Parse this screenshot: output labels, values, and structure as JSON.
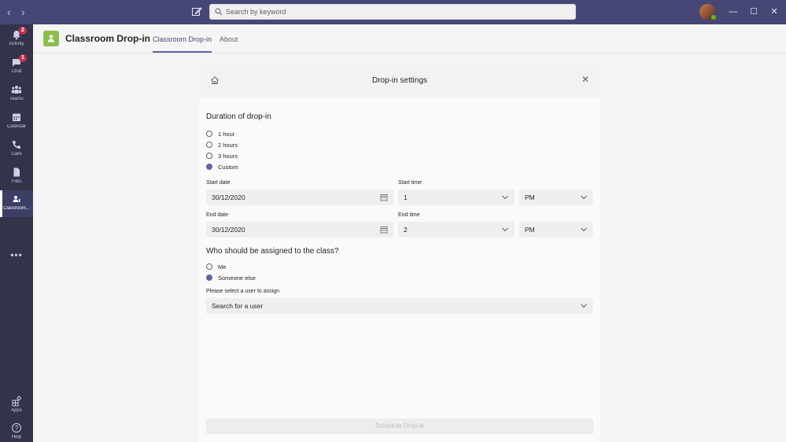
{
  "titlebar": {
    "search_placeholder": "Search by keyword",
    "back_icon": "chevron-left-icon",
    "forward_icon": "chevron-right-icon",
    "compose_icon": "compose-icon",
    "minimize": "—",
    "maximize": "☐",
    "close": "✕"
  },
  "rail": {
    "items": [
      {
        "label": "Activity",
        "icon": "bell-icon",
        "badge": "2"
      },
      {
        "label": "Chat",
        "icon": "chat-icon",
        "badge": "1"
      },
      {
        "label": "Teams",
        "icon": "teams-icon"
      },
      {
        "label": "Calendar",
        "icon": "calendar-icon"
      },
      {
        "label": "Calls",
        "icon": "phone-icon"
      },
      {
        "label": "Files",
        "icon": "file-icon"
      },
      {
        "label": "Classroom...",
        "icon": "classroom-icon",
        "active": true
      }
    ],
    "more": "•••",
    "bottom": [
      {
        "label": "Apps",
        "icon": "apps-icon"
      },
      {
        "label": "Help",
        "icon": "help-icon"
      }
    ]
  },
  "app": {
    "title": "Classroom Drop-in",
    "tabs": [
      {
        "label": "Classroom Drop-in",
        "active": true
      },
      {
        "label": "About",
        "active": false
      }
    ],
    "accent": "#6264a7",
    "logo_color": "#8cbf4a"
  },
  "panel": {
    "title": "Drop-in settings",
    "duration": {
      "heading": "Duration of drop-in",
      "options": [
        "1 hour",
        "2 hours",
        "3 hours",
        "Custom"
      ],
      "selected": "Custom"
    },
    "start_date_label": "Start date",
    "start_date_value": "30/12/2020",
    "start_time_label": "Start time",
    "start_time_hour": "1",
    "start_time_ampm": "PM",
    "end_date_label": "End date",
    "end_date_value": "30/12/2020",
    "end_time_label": "End time",
    "end_time_hour": "2",
    "end_time_ampm": "PM",
    "assign": {
      "heading": "Who should be assigned to the class?",
      "options": [
        "Me",
        "Someone else"
      ],
      "selected": "Someone else"
    },
    "user_select_label": "Please select a user to assign",
    "user_select_placeholder": "Search for a user",
    "submit_label": "Schedule Drop-in"
  }
}
